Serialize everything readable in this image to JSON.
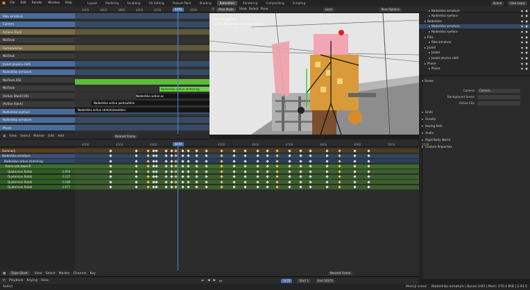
{
  "topbar": {
    "menus": [
      "File",
      "Edit",
      "Render",
      "Window",
      "Help"
    ],
    "workspaces": [
      "Layout",
      "Modeling",
      "Sculpting",
      "UV Editing",
      "Texture Paint",
      "Shading",
      "Animation",
      "Rendering",
      "Compositing",
      "Scripting"
    ],
    "active_workspace": "Animation",
    "scene_label": "Scene",
    "view_layer_label": "View Layer"
  },
  "nla": {
    "tracks": [
      {
        "label": "Rika armature",
        "kind": "object"
      },
      {
        "label": "Camera",
        "kind": "object"
      },
      {
        "label": "Actions Track",
        "kind": "action"
      },
      {
        "label": "NlaTrack",
        "kind": "track"
      },
      {
        "label": "CameraAction",
        "kind": "action"
      },
      {
        "label": "NlaTrack",
        "kind": "track"
      },
      {
        "label": "Jacket physics cloth",
        "kind": "object"
      },
      {
        "label": "Nadeshiko armature",
        "kind": "object"
      },
      {
        "label": "NlaTrack.002",
        "kind": "track"
      },
      {
        "label": "NlaTrack",
        "kind": "track"
      },
      {
        "label": "[Action Stash] 001",
        "kind": "track"
      },
      {
        "label": "[Action Stash]",
        "kind": "track"
      },
      {
        "label": "Nadeshiko eyeface",
        "kind": "object"
      },
      {
        "label": "Nadeshiko armature",
        "kind": "object"
      },
      {
        "label": "Phone",
        "kind": "object"
      }
    ],
    "ruler": [
      "3400",
      "3600",
      "3800",
      "4000",
      "4200",
      "4400",
      "4600"
    ],
    "current_frame": "4470",
    "strips": {
      "active": "Nadeshiko active stretching",
      "action_a": "Nadeshiko action.ac",
      "action_b": "Nadeshiko active pantsuitline",
      "action_c": "Nadeshiko active stretchshoulders"
    },
    "footer": {
      "menus": [
        "View",
        "Select",
        "Marker",
        "Edit",
        "Add"
      ],
      "snap": "Nearest Frame"
    }
  },
  "viewport": {
    "title": "User Perspective",
    "subtitle": "(4470) Nadeshiko armature : Heavy...",
    "mode": "Pose Mode",
    "menus": [
      "View",
      "Select",
      "Pose"
    ],
    "orientation": "Local",
    "options": "Pose Options"
  },
  "dopesheet": {
    "ruler": [
      "4200",
      "4300",
      "4400",
      "4470",
      "4500",
      "4600",
      "4700",
      "4800",
      "4900",
      "5000",
      "5100"
    ],
    "channels": [
      {
        "label": "Summary",
        "kind": "summary",
        "value": ""
      },
      {
        "label": "Nadeshiko armature",
        "kind": "object",
        "value": ""
      },
      {
        "label": "Nadeshiko active stretching",
        "kind": "action",
        "value": ""
      },
      {
        "label": "Ibone.arm.lower.R",
        "kind": "group",
        "value": ""
      },
      {
        "label": "Quaternion Rotati",
        "kind": "fcurve",
        "value": "0.959"
      },
      {
        "label": "Quaternion Rotati",
        "kind": "fcurve",
        "value": "0.227"
      },
      {
        "label": "Quaternion Rotati",
        "kind": "fcurve",
        "value": "0.086"
      },
      {
        "label": "Quaternion Rotati",
        "kind": "fcurve",
        "value": "0.077"
      }
    ],
    "footer": {
      "mode": "Dope Sheet",
      "menus": [
        "View",
        "Select",
        "Marker",
        "Channel",
        "Key"
      ],
      "snap": "Nearest Frame"
    }
  },
  "timeline": {
    "menus": [
      "Playback",
      "Keying",
      "View"
    ],
    "current": "4470",
    "start_label": "Start",
    "start": "1",
    "end_label": "End",
    "end": "10370"
  },
  "outliner": {
    "items": [
      {
        "label": "Nadeshiko armature",
        "depth": 1
      },
      {
        "label": "Nadeshiko eyeface",
        "depth": 1
      },
      {
        "label": "Nadeshiko",
        "depth": 0
      },
      {
        "label": "Nadeshiko armature",
        "depth": 1
      },
      {
        "label": "Nadeshiko eyeface",
        "depth": 1
      },
      {
        "label": "Rika",
        "depth": 0
      },
      {
        "label": "Rika armature",
        "depth": 1
      },
      {
        "label": "Jacket",
        "depth": 0
      },
      {
        "label": "Jacket",
        "depth": 1
      },
      {
        "label": "Jacket physics cloth",
        "depth": 1
      },
      {
        "label": "Phone",
        "depth": 0
      },
      {
        "label": "Phone",
        "depth": 1
      }
    ]
  },
  "properties": {
    "panel": "Scene",
    "camera_label": "Camera",
    "camera_value": "Camera",
    "bg_label": "Background Scene",
    "clip_label": "Active Clip",
    "sections": [
      "Units",
      "Gravity",
      "Keying Sets",
      "Audio",
      "Rigid Body World",
      "Custom Properties"
    ]
  },
  "statusbar": {
    "left": "Select",
    "right": "Nadeshiko armature | Bones:1/83 | Mem: 276.4 MiB | 2.93.5",
    "scene_name": "Momiji scene"
  },
  "colors": {
    "accent": "#4772b3",
    "green": "#5bbd3a",
    "playhead": "#4a8ad8",
    "orange": "#e6a040"
  }
}
